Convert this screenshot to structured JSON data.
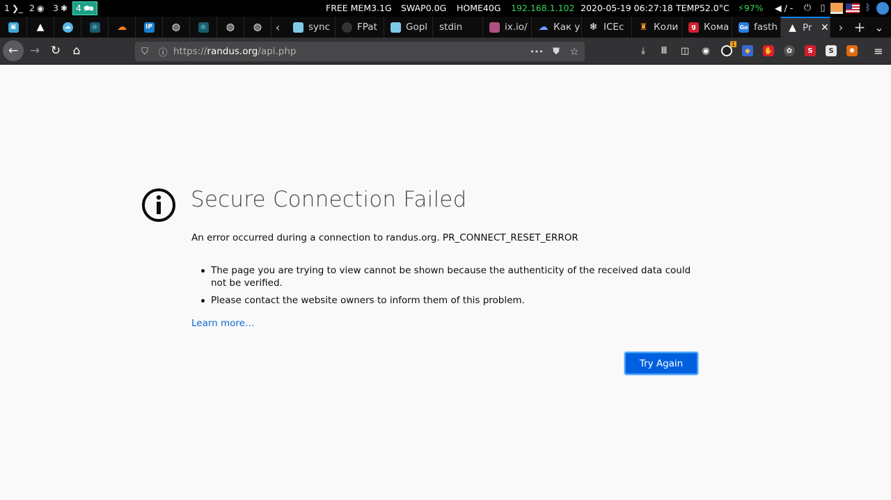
{
  "system_bar": {
    "workspaces": [
      {
        "num": "1",
        "glyph": "❯_"
      },
      {
        "num": "2",
        "glyph": "◉"
      },
      {
        "num": "3",
        "glyph": "✱"
      },
      {
        "num": "4",
        "glyph": "🗪"
      }
    ],
    "free_mem": "FREE MEM3.1G",
    "swap": "SWAP0.0G",
    "home": "HOME40G",
    "ip": "192.168.1.102",
    "datetime": "2020-05-19 06:27:18",
    "temp": "TEMP52.0°C",
    "battery": "⚡97%",
    "volume": "◀ / -",
    "colors": {
      "ip": "#39d353",
      "battery": "#39d353",
      "active_workspace": "#1f9f86"
    }
  },
  "tabs": {
    "pinned": [
      {
        "icon": "box-icon",
        "color": "#3fa9d8"
      },
      {
        "icon": "warning-icon",
        "color": "#ffffff"
      },
      {
        "icon": "cloud-icon",
        "color": "#58b8e8"
      },
      {
        "icon": "atom-icon",
        "color": "#3fc1d8"
      },
      {
        "icon": "cloudflare-icon",
        "color": "#f38020"
      },
      {
        "icon": "ip-icon",
        "color": "#1a7fd0"
      },
      {
        "icon": "globe-icon",
        "color": "#ffffff"
      },
      {
        "icon": "atom-icon",
        "color": "#3fc1d8"
      },
      {
        "icon": "globe-icon",
        "color": "#ffffff"
      },
      {
        "icon": "globe-icon",
        "color": "#ffffff"
      }
    ],
    "open": [
      {
        "title": "sync",
        "icon": "box-icon",
        "color": "#7fc9e8"
      },
      {
        "title": "FPat",
        "icon": "github-icon",
        "color": "#333333"
      },
      {
        "title": "Gopl",
        "icon": "box-icon",
        "color": "#7fc9e8"
      },
      {
        "title": "stdin",
        "icon": "none",
        "color": "#0c0c0d"
      },
      {
        "title": "ix.io/",
        "icon": "image-icon",
        "color": "#b05080"
      },
      {
        "title": "Как у",
        "icon": "cloud-icon",
        "color": "#6aa0ff"
      },
      {
        "title": "ICEc",
        "icon": "snowflake-icon",
        "color": "#ffffff"
      },
      {
        "title": "Коли",
        "icon": "candle-icon",
        "color": "#f0a020"
      },
      {
        "title": "Кома",
        "icon": "red-g-icon",
        "color": "#d02030"
      },
      {
        "title": "fasth",
        "icon": "go-icon",
        "color": "#2a7de1"
      },
      {
        "title": "Pr",
        "icon": "warning-icon",
        "color": "#ffffff"
      }
    ],
    "close_label": "✕",
    "new_tab_label": "+",
    "scroll_left_label": "‹",
    "scroll_right_label": "›",
    "menu_label": "⌄"
  },
  "navbar": {
    "url_protocol": "https://",
    "url_host": "randus.org",
    "url_path": "/api.php",
    "page_actions_label": "•••",
    "extension_badge": "1"
  },
  "error_page": {
    "title": "Secure Connection Failed",
    "description": "An error occurred during a connection to randus.org. PR_CONNECT_RESET_ERROR",
    "bullets": [
      "The page you are trying to view cannot be shown because the authenticity of the received data could not be verified.",
      "Please contact the website owners to inform them of this problem."
    ],
    "learn_more": "Learn more…",
    "try_again": "Try Again"
  }
}
